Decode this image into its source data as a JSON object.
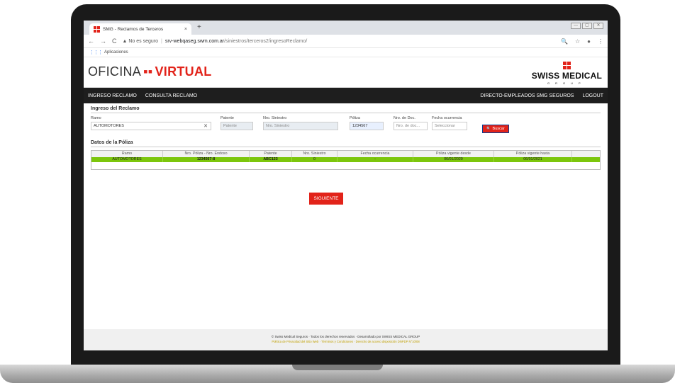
{
  "browser": {
    "tab_title": "SMG - Reclamos de Terceros",
    "tab_close": "×",
    "new_tab": "+",
    "win_min": "—",
    "win_max": "▢",
    "win_close": "✕",
    "back": "←",
    "forward": "→",
    "reload": "C",
    "security_label": "▲ No es seguro",
    "url_host": "srv-webqaseg.swm.com.ar",
    "url_path": "/siniestros/terceros2/ingresoReclamo/",
    "zoom_icon": "🔍",
    "star_icon": "☆",
    "profile_icon": "●",
    "menu_icon": "⋮",
    "bookmarks_label": "Aplicaciones"
  },
  "header": {
    "logo_left_a": "OFICINA",
    "logo_left_dots": "▪▪",
    "logo_left_b": "VIRTUAL",
    "logo_right_name": "SWISS MEDICAL",
    "logo_right_group": "GROUP"
  },
  "nav": {
    "ingreso": "INGRESO RECLAMO",
    "consulta": "CONSULTA RECLAMO",
    "directo": "DIRECTO-EMPLEADOS SMG SEGUROS",
    "logout": "LOGOUT"
  },
  "ingreso": {
    "title": "Ingreso del Reclamo",
    "ramo_label": "Ramo",
    "ramo_value": "AUTOMOTORES",
    "ramo_clear": "✕",
    "patente_label": "Patente",
    "patente_placeholder": "Patente",
    "siniestro_label": "Nro. Siniestro",
    "siniestro_placeholder": "Nro. Siniestro",
    "poliza_label": "Póliza",
    "poliza_value": "1234567",
    "doc_label": "Nro. de Doc.",
    "doc_placeholder": "Nro. de doc...",
    "fecha_label": "Fecha ocurrencia",
    "fecha_placeholder": "Seleccionar",
    "buscar": "Buscar",
    "buscar_icon": "🔍"
  },
  "poliza": {
    "title": "Datos de la Póliza",
    "columns": [
      "Ramo",
      "Nro. Póliza - Nro. Endoso",
      "Patente",
      "Nro. Siniestro",
      "Fecha ocurrencia",
      "Póliza vigente desde",
      "Póliza vigente hasta"
    ],
    "row": [
      "AUTOMOTORES",
      "1234567-8",
      "ABC123",
      "0",
      "-",
      "06/01/2020",
      "06/01/2021"
    ]
  },
  "siguiente": "SIGUIENTE",
  "footer": {
    "line1": "© Swiss Medical Seguros · Todos los derechos reservados · Desarrollado por SWISS MEDICAL GROUP",
    "line2": "Política de Privacidad del Sitio Web · Términos y Condiciones · Derecho de acceso disposición DNPDP N°10/08"
  },
  "colors": {
    "brand_red": "#e2231a",
    "nav_dark": "#1e1e1e",
    "row_green": "#7cc60c"
  }
}
